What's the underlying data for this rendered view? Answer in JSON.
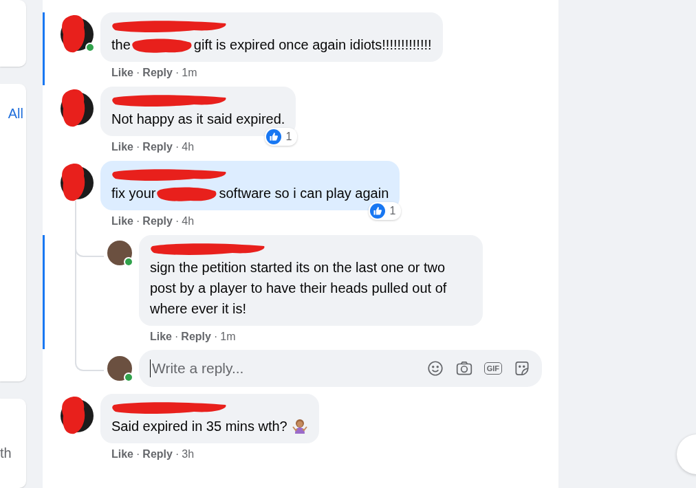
{
  "left_panel": {
    "link": "All",
    "text_fragment": "th"
  },
  "comments": [
    {
      "online": true,
      "new": true,
      "highlighted": false,
      "name_redacted": true,
      "body": [
        {
          "kind": "text",
          "text": "the"
        },
        {
          "kind": "redaction"
        },
        {
          "kind": "text",
          "text": "gift is expired once again idiots!!!!!!!!!!!!!"
        }
      ],
      "meta": [
        {
          "kind": "action",
          "text": "Like"
        },
        {
          "kind": "sep",
          "text": "·"
        },
        {
          "kind": "action",
          "text": "Reply"
        },
        {
          "kind": "sep",
          "text": "·"
        },
        {
          "kind": "time",
          "text": "1m"
        }
      ]
    },
    {
      "online": false,
      "new": false,
      "highlighted": false,
      "name_redacted": true,
      "body": [
        {
          "kind": "text",
          "text": "Not happy as it said expired."
        }
      ],
      "meta": [
        {
          "kind": "action",
          "text": "Like"
        },
        {
          "kind": "sep",
          "text": "·"
        },
        {
          "kind": "action",
          "text": "Reply"
        },
        {
          "kind": "sep",
          "text": "·"
        },
        {
          "kind": "time",
          "text": "4h"
        }
      ],
      "reaction_count": "1"
    },
    {
      "online": false,
      "new": false,
      "highlighted": true,
      "name_redacted": true,
      "body": [
        {
          "kind": "text",
          "text": "fix your"
        },
        {
          "kind": "redaction"
        },
        {
          "kind": "text",
          "text": "software so i can play again"
        }
      ],
      "meta": [
        {
          "kind": "action",
          "text": "Like"
        },
        {
          "kind": "sep",
          "text": "·"
        },
        {
          "kind": "action",
          "text": "Reply"
        },
        {
          "kind": "sep",
          "text": "·"
        },
        {
          "kind": "time",
          "text": "4h"
        }
      ],
      "reaction_count": "1",
      "replies": [
        {
          "online": true,
          "new": true,
          "highlighted": false,
          "name_redacted": true,
          "body": [
            {
              "kind": "text",
              "text": "sign the petition started its on the last one or two post by a player to have their heads pulled out of where ever it is!"
            }
          ],
          "meta": [
            {
              "kind": "action",
              "text": "Like"
            },
            {
              "kind": "sep",
              "text": "·"
            },
            {
              "kind": "action",
              "text": "Reply"
            },
            {
              "kind": "sep",
              "text": "·"
            },
            {
              "kind": "time",
              "text": "1m"
            }
          ]
        }
      ],
      "reply_box": {
        "online": true,
        "placeholder": "Write a reply...",
        "gif_label": "GIF"
      }
    },
    {
      "online": false,
      "new": false,
      "highlighted": false,
      "name_redacted": true,
      "body": [
        {
          "kind": "text",
          "text": "Said expired in 35 mins wth?"
        },
        {
          "kind": "emoji"
        }
      ],
      "meta": [
        {
          "kind": "action",
          "text": "Like"
        },
        {
          "kind": "sep",
          "text": "·"
        },
        {
          "kind": "action",
          "text": "Reply"
        },
        {
          "kind": "sep",
          "text": "·"
        },
        {
          "kind": "time",
          "text": "3h"
        }
      ]
    }
  ]
}
